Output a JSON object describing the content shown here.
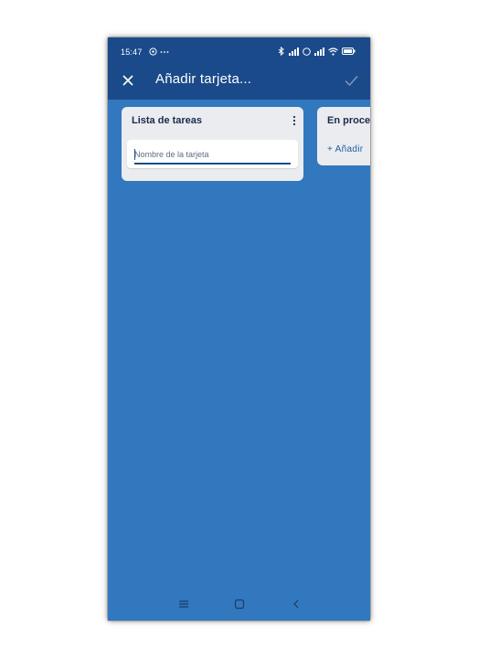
{
  "status_bar": {
    "time": "15:47",
    "extra_icons": [
      "notification-icon",
      "ellipsis-icon"
    ],
    "right_icons": [
      "bluetooth-icon",
      "signal-icon",
      "signal-icon",
      "wifi-icon",
      "battery-icon"
    ]
  },
  "app_bar": {
    "close_icon": "close-icon",
    "title": "Añadir tarjeta...",
    "confirm_icon": "check-icon"
  },
  "board": {
    "lists": [
      {
        "title": "Lista de tareas",
        "menu_icon": "more-vertical-icon",
        "new_card": {
          "value": "",
          "placeholder": "Nombre de la tarjeta"
        }
      },
      {
        "title": "En proce",
        "add_card_label": "+ Añadir"
      }
    ]
  },
  "nav_bar": {
    "buttons": [
      "menu-icon",
      "home-icon",
      "back-icon"
    ]
  },
  "colors": {
    "app_bar": "#1b4a8a",
    "board_background": "#3278bf",
    "list_background": "#ebecf0",
    "accent": "#1e5ea6"
  }
}
